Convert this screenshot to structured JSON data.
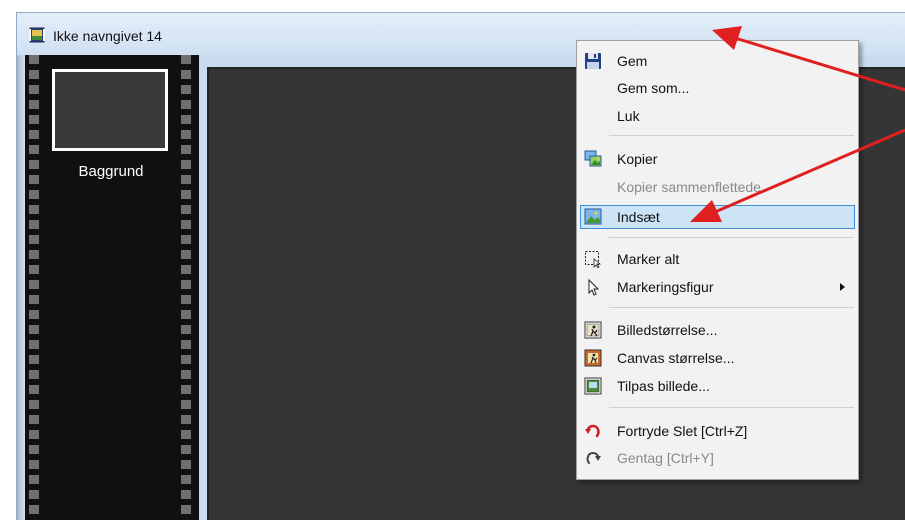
{
  "window": {
    "title": "Ikke navngivet 14"
  },
  "layers": [
    {
      "label": "Baggrund"
    }
  ],
  "context_menu": {
    "items": [
      {
        "label": "Gem",
        "icon": "floppy-disk-icon",
        "enabled": true
      },
      {
        "label": "Gem som...",
        "icon": "",
        "enabled": true
      },
      {
        "label": "Luk",
        "icon": "",
        "enabled": true
      },
      {
        "label": "Kopier",
        "icon": "copy-image-icon",
        "enabled": true
      },
      {
        "label": "Kopier sammenflettede",
        "icon": "",
        "enabled": false
      },
      {
        "label": "Indsæt",
        "icon": "paste-image-icon",
        "enabled": true,
        "highlighted": true
      },
      {
        "label": "Marker alt",
        "icon": "select-all-icon",
        "enabled": true
      },
      {
        "label": "Markeringsfigur",
        "icon": "cursor-icon",
        "enabled": true,
        "submenu": true
      },
      {
        "label": "Billedstørrelse...",
        "icon": "image-size-icon",
        "enabled": true
      },
      {
        "label": "Canvas størrelse...",
        "icon": "canvas-size-icon",
        "enabled": true
      },
      {
        "label": "Tilpas billede...",
        "icon": "fit-image-icon",
        "enabled": true
      },
      {
        "label": "Fortryde Slet [Ctrl+Z]",
        "icon": "undo-icon",
        "enabled": true
      },
      {
        "label": "Gentag [Ctrl+Y]",
        "icon": "redo-icon",
        "enabled": false
      }
    ]
  },
  "colors": {
    "annotation_arrow": "#e02020",
    "highlight_bg": "#cde4f7",
    "highlight_border": "#3b8fd8",
    "canvas_bg": "#353535",
    "filmstrip_bg": "#101010"
  }
}
